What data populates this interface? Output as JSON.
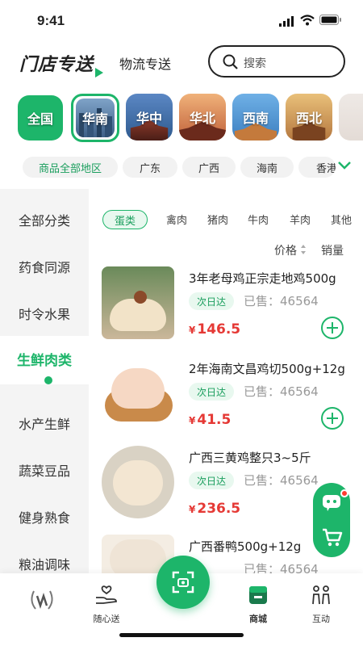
{
  "status": {
    "time": "9:41"
  },
  "header": {
    "logo_text": "门店专送",
    "tab_logistics": "物流专送",
    "search_placeholder": "搜索"
  },
  "regions": [
    {
      "label": "全国"
    },
    {
      "label": "华南"
    },
    {
      "label": "华中"
    },
    {
      "label": "华北"
    },
    {
      "label": "西南"
    },
    {
      "label": "西北"
    }
  ],
  "subregions": [
    "商品全部地区",
    "广东",
    "广西",
    "海南",
    "香港"
  ],
  "sidebar": [
    "全部分类",
    "药食同源",
    "时令水果",
    "生鲜肉类",
    "水产生鲜",
    "蔬菜豆品",
    "健身熟食",
    "粮油调味"
  ],
  "filters": [
    "蛋类",
    "禽肉",
    "猪肉",
    "牛肉",
    "羊肉",
    "其他"
  ],
  "sort": {
    "price": "价格",
    "sales": "销量"
  },
  "products": [
    {
      "name": "3年老母鸡正宗走地鸡500g",
      "badge": "次日达",
      "sold": "已售：46564",
      "currency": "¥",
      "price": "146.5"
    },
    {
      "name": "2年海南文昌鸡切500g+12g",
      "badge": "次日达",
      "sold": "已售：46564",
      "currency": "¥",
      "price": "41.5"
    },
    {
      "name": "广西三黄鸡整只3~5斤",
      "badge": "次日达",
      "sold": "已售：46564",
      "currency": "¥",
      "price": "236.5"
    },
    {
      "name": "广西番鸭500g+12g",
      "badge": "次日达",
      "sold": "已售：46564",
      "currency": "¥",
      "price": ""
    }
  ],
  "tabbar": {
    "home": "",
    "care": "随心送",
    "mall": "商城",
    "interact": "互动"
  },
  "colors": {
    "accent": "#1db56a",
    "price": "#e53935",
    "sidebar_bg": "#f4f4f4"
  }
}
